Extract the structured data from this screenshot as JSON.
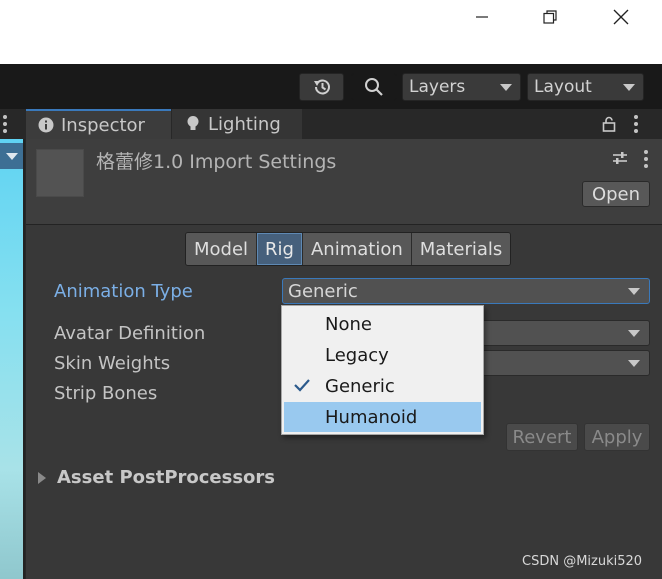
{
  "window": {
    "minimize_icon": "minimize-icon",
    "restore_icon": "restore-icon",
    "close_icon": "close-icon"
  },
  "toolbar": {
    "history_icon": "history-icon",
    "search_icon": "search-icon",
    "layers_label": "Layers",
    "layout_label": "Layout"
  },
  "tabs": {
    "inspector": "Inspector",
    "lighting": "Lighting",
    "inspector_icon": "info-icon",
    "lighting_icon": "lightbulb-icon",
    "lock_icon": "lock-icon"
  },
  "header": {
    "title": "格蕾修1.0 Import Settings",
    "open_label": "Open",
    "settings_icon": "sliders-icon"
  },
  "import_tabs": [
    "Model",
    "Rig",
    "Animation",
    "Materials"
  ],
  "selected_tab": "Rig",
  "properties": {
    "animation_type_label": "Animation Type",
    "animation_type_value": "Generic",
    "avatar_definition_label": "Avatar Definition",
    "skin_weights_label": "Skin Weights",
    "strip_bones_label": "Strip Bones"
  },
  "buttons": {
    "revert": "Revert",
    "apply": "Apply"
  },
  "foldout": {
    "asset_postprocessors": "Asset PostProcessors"
  },
  "dropdown_menu": {
    "items": [
      "None",
      "Legacy",
      "Generic",
      "Humanoid"
    ],
    "checked": "Generic",
    "hovered": "Humanoid"
  },
  "watermark": "CSDN @Mizuki520",
  "colors": {
    "accent_blue": "#3a79bb",
    "label_highlight": "#7bafe6",
    "menu_hover": "#99c9ef",
    "panel_bg": "#383838"
  }
}
